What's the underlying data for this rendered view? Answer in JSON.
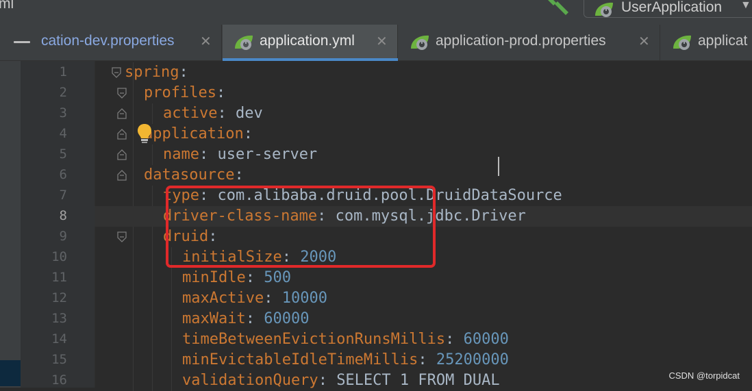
{
  "window": {
    "title_fragment": "ml"
  },
  "toolbar": {
    "run_configuration": "UserApplication",
    "build_icon": "hammer-icon",
    "dropdown_icon": "caret-down-icon"
  },
  "tabs": [
    {
      "label": "cation-dev.properties",
      "active": false,
      "icon": "spring-boot-icon"
    },
    {
      "label": "application.yml",
      "active": true,
      "icon": "spring-boot-icon"
    },
    {
      "label": "application-prod.properties",
      "active": false,
      "icon": "spring-boot-icon"
    },
    {
      "label": "applicat",
      "active": false,
      "icon": "spring-boot-icon"
    }
  ],
  "editor": {
    "file_type": "yaml",
    "current_line": 8,
    "lines": [
      {
        "n": "1",
        "indent": 0,
        "key": "spring",
        "value": ""
      },
      {
        "n": "2",
        "indent": 1,
        "key": "profiles",
        "value": ""
      },
      {
        "n": "3",
        "indent": 2,
        "key": "active",
        "value": "dev"
      },
      {
        "n": "4",
        "indent": 1,
        "key": "application",
        "value": ""
      },
      {
        "n": "5",
        "indent": 2,
        "key": "name",
        "value": "user-server"
      },
      {
        "n": "6",
        "indent": 1,
        "key": "datasource",
        "value": ""
      },
      {
        "n": "7",
        "indent": 2,
        "key": "type",
        "value": "com.alibaba.druid.pool.DruidDataSource"
      },
      {
        "n": "8",
        "indent": 2,
        "key": "driver-class-name",
        "value": "com.mysql.jdbc.Driver"
      },
      {
        "n": "9",
        "indent": 2,
        "key": "druid",
        "value": ""
      },
      {
        "n": "10",
        "indent": 3,
        "key": "initialSize",
        "value": "2000"
      },
      {
        "n": "11",
        "indent": 3,
        "key": "minIdle",
        "value": "500"
      },
      {
        "n": "12",
        "indent": 3,
        "key": "maxActive",
        "value": "10000"
      },
      {
        "n": "13",
        "indent": 3,
        "key": "maxWait",
        "value": "60000"
      },
      {
        "n": "14",
        "indent": 3,
        "key": "timeBetweenEvictionRunsMillis",
        "value": "60000"
      },
      {
        "n": "15",
        "indent": 3,
        "key": "minEvictableIdleTimeMillis",
        "value": "25200000"
      },
      {
        "n": "16",
        "indent": 3,
        "key": "validationQuery",
        "value": "SELECT 1 FROM DUAL"
      }
    ],
    "intention_icon": "lightbulb-icon",
    "highlight_color": "#e0292a"
  },
  "watermark": "CSDN @torpidcat"
}
